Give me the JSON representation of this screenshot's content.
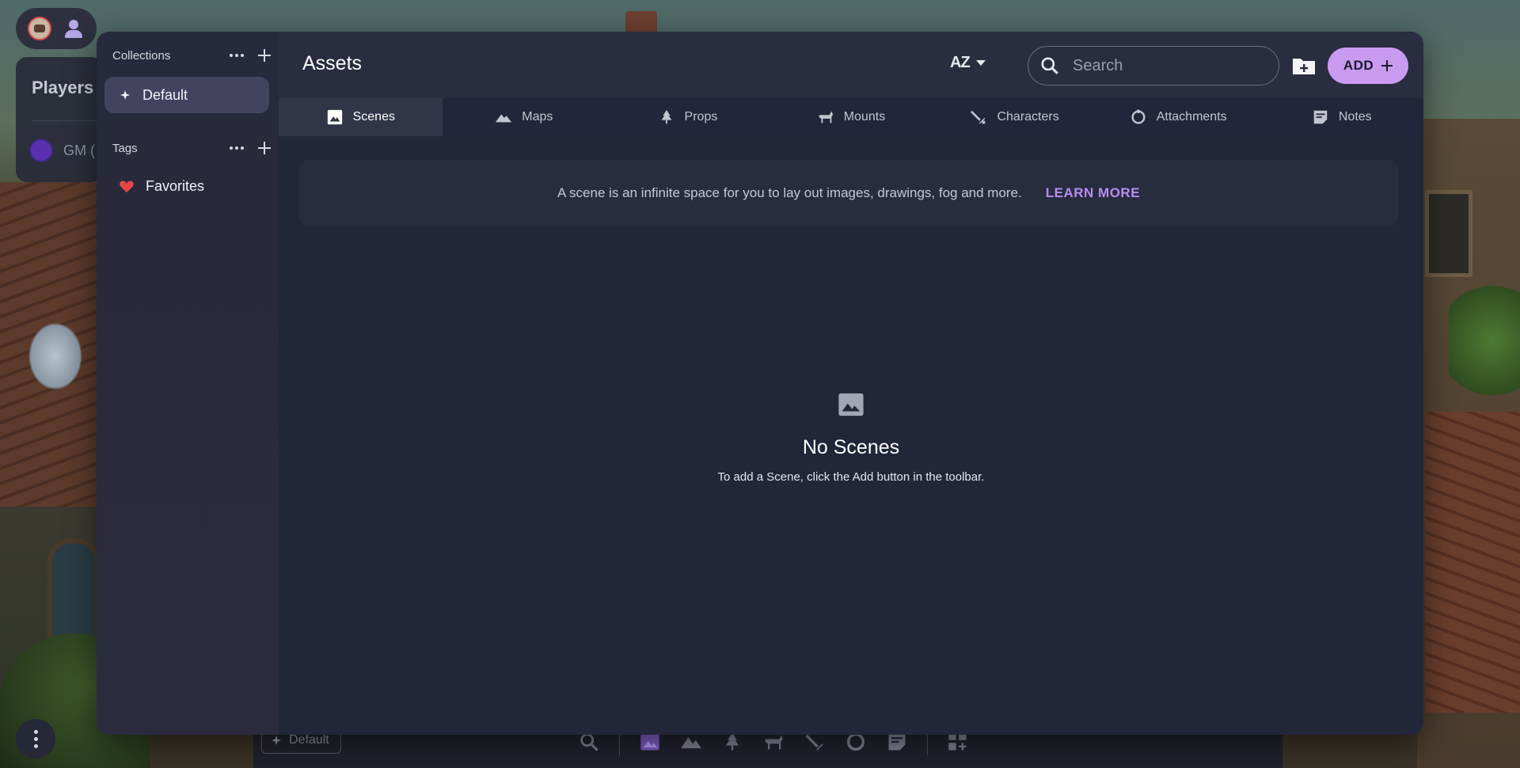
{
  "background": {
    "players_title": "Players",
    "gm_label": "GM (",
    "bottom_collection": "Default"
  },
  "sidebar": {
    "collections_title": "Collections",
    "collections": [
      {
        "label": "Default",
        "active": true
      }
    ],
    "tags_title": "Tags",
    "tags": [
      {
        "label": "Favorites",
        "icon": "heart-icon"
      }
    ]
  },
  "header": {
    "title": "Assets",
    "sort_label": "AZ",
    "search_placeholder": "Search",
    "add_label": "ADD"
  },
  "tabs": [
    {
      "label": "Scenes",
      "icon": "image-icon",
      "active": true
    },
    {
      "label": "Maps",
      "icon": "mountain-icon",
      "active": false
    },
    {
      "label": "Props",
      "icon": "tree-icon",
      "active": false
    },
    {
      "label": "Mounts",
      "icon": "horse-icon",
      "active": false
    },
    {
      "label": "Characters",
      "icon": "sword-icon",
      "active": false
    },
    {
      "label": "Attachments",
      "icon": "ring-icon",
      "active": false
    },
    {
      "label": "Notes",
      "icon": "note-icon",
      "active": false
    }
  ],
  "banner": {
    "text": "A scene is an infinite space for you to lay out images, drawings, fog and more.",
    "link": "LEARN MORE"
  },
  "empty_state": {
    "title": "No Scenes",
    "subtitle": "To add a Scene, click the Add button in the toolbar."
  },
  "colors": {
    "accent": "#c99bf0",
    "link": "#b78ef0",
    "panel": "#222639",
    "sidebar": "#272a3c"
  }
}
